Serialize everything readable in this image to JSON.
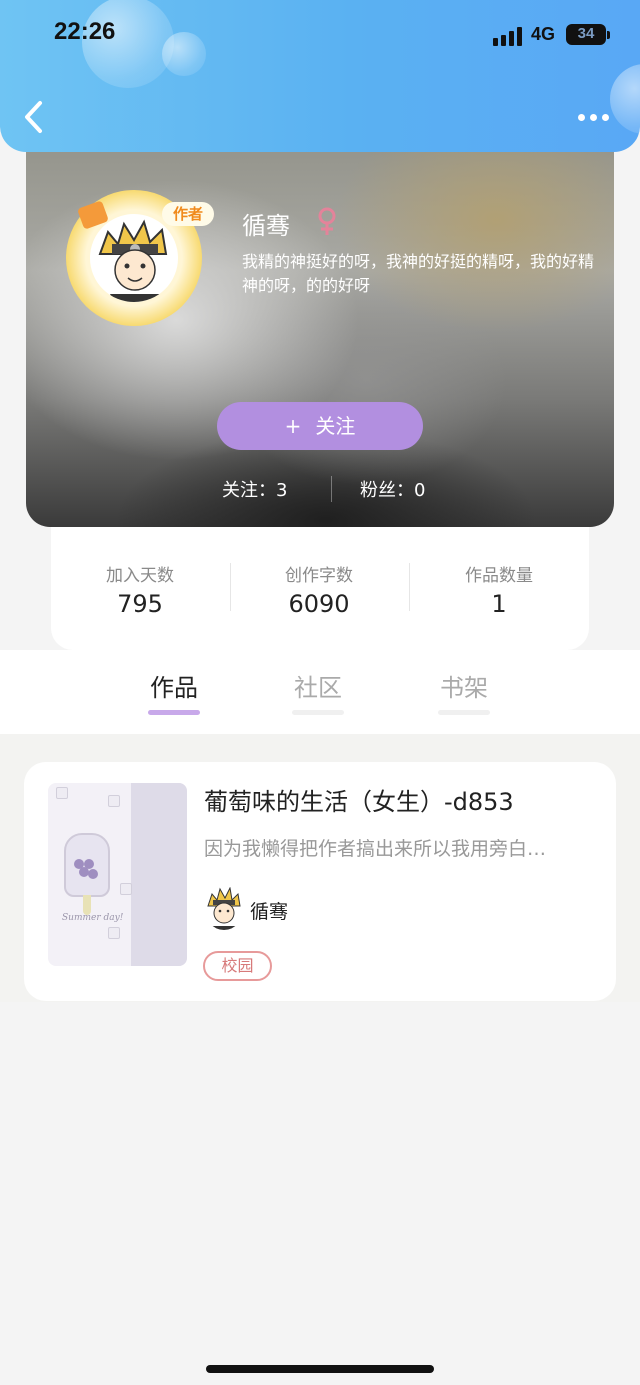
{
  "status_bar": {
    "time": "22:26",
    "network": "4G",
    "battery": "34"
  },
  "nav": {
    "back_icon": "chevron-left-icon",
    "more_icon": "more-dots-icon"
  },
  "profile": {
    "author_badge": "作者",
    "name": "循骞",
    "gender_icon": "female-symbol-icon",
    "bio": "我精的神挺好的呀，我神的好挺的精呀，我的好精神的呀，的的好呀",
    "follow_button": "关注",
    "follow_plus": "+",
    "following": "关注：3",
    "fans": "粉丝：0"
  },
  "stats": [
    {
      "label": "加入天数",
      "value": "795"
    },
    {
      "label": "创作字数",
      "value": "6090"
    },
    {
      "label": "作品数量",
      "value": "1"
    }
  ],
  "tabs": [
    {
      "label": "作品",
      "active": true
    },
    {
      "label": "社区",
      "active": false
    },
    {
      "label": "书架",
      "active": false
    }
  ],
  "works": [
    {
      "title": "葡萄味的生活（女生）-d853",
      "description": "因为我懒得把作者搞出来所以我用旁白…",
      "author": "循骞",
      "tag": "校园",
      "cover_caption": "Summer day!"
    }
  ],
  "colors": {
    "header": "#5ab1f2",
    "follow_button": "#b28fe0",
    "active_tab_indicator": "#c8a9ea",
    "tag_border": "#e79a9a"
  }
}
